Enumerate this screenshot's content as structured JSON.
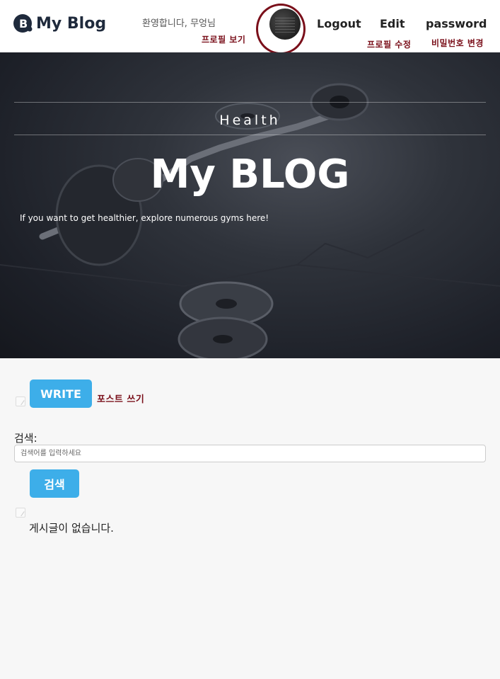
{
  "header": {
    "brand": "My Blog",
    "welcome": "환영합니다, 무엉님",
    "view_profile_note": "프로필 보기",
    "nav": {
      "logout": "Logout",
      "edit": "Edit",
      "password": "password"
    },
    "edit_note": "프로필 수정",
    "password_note": "비밀번호 변경"
  },
  "hero": {
    "tag": "Health",
    "title": "My BLOG",
    "subtitle": "If you want to get healthier, explore numerous gyms here!"
  },
  "main": {
    "write_button": "WRITE",
    "write_note": "포스트 쓰기",
    "search_label": "검색:",
    "search_placeholder": "검색어를 입력하세요",
    "search_value": "",
    "search_button": "검색",
    "empty_message": "게시글이 없습니다."
  },
  "colors": {
    "accent": "#3daee9",
    "annotation": "#7a0f1a",
    "brand": "#1f2a3c"
  }
}
